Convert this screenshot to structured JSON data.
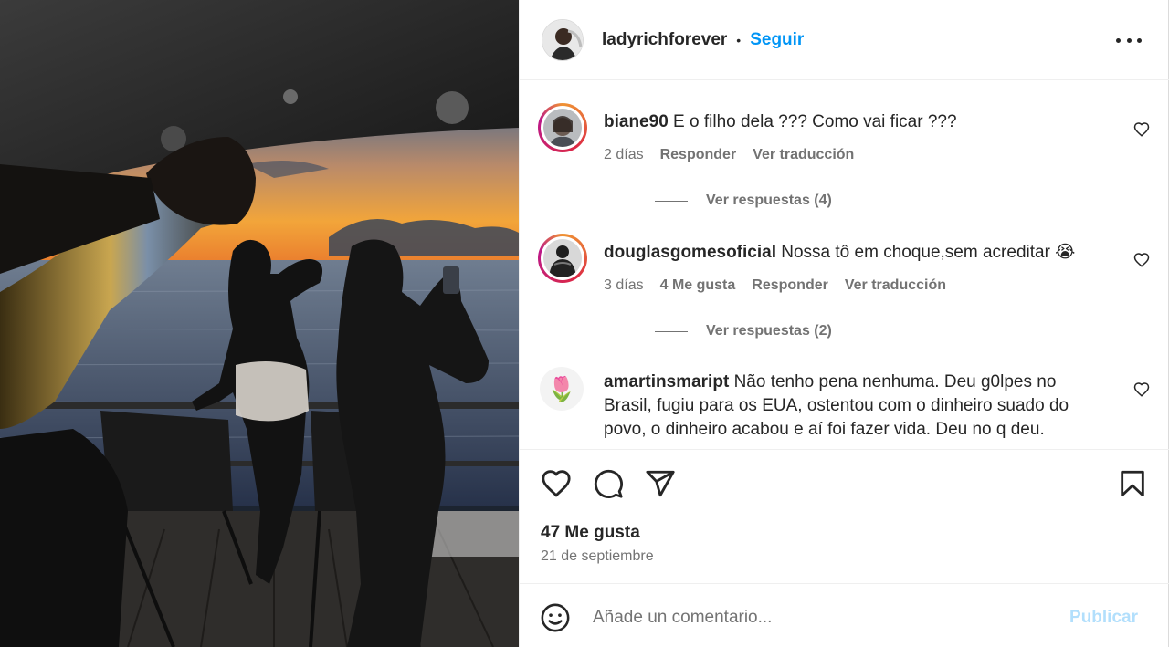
{
  "post": {
    "author": "ladyrichforever",
    "separator": "•",
    "follow_label": "Seguir",
    "more_icon": "more-horizontal-icon"
  },
  "comments": [
    {
      "user": "biane90",
      "text": "E o filho dela ??? Como vai ficar ???",
      "time": "2 días",
      "reply_label": "Responder",
      "translate_label": "Ver traducción",
      "replies_label": "Ver respuestas (4)"
    },
    {
      "user": "douglasgomesoficial",
      "text": "Nossa tô em choque,sem acreditar 😭",
      "time": "3 días",
      "likes_label": "4 Me gusta",
      "reply_label": "Responder",
      "translate_label": "Ver traducción",
      "replies_label": "Ver respuestas (2)"
    },
    {
      "user": "amartinsmaript",
      "text": "Não tenho pena nenhuma. Deu g0lpes no Brasil, fugiu para os EUA, ostentou com o dinheiro suado do povo, o dinheiro acabou e aí foi fazer vida. Deu no q deu.",
      "avatar_emoji": "🌷"
    }
  ],
  "actions": {
    "likes": "47 Me gusta",
    "date": "21 de septiembre"
  },
  "composer": {
    "placeholder": "Añade un comentario...",
    "publish_label": "Publicar"
  },
  "colors": {
    "accent": "#0095f6",
    "publish_disabled": "#b2dffc",
    "secondary_text": "#737373"
  }
}
